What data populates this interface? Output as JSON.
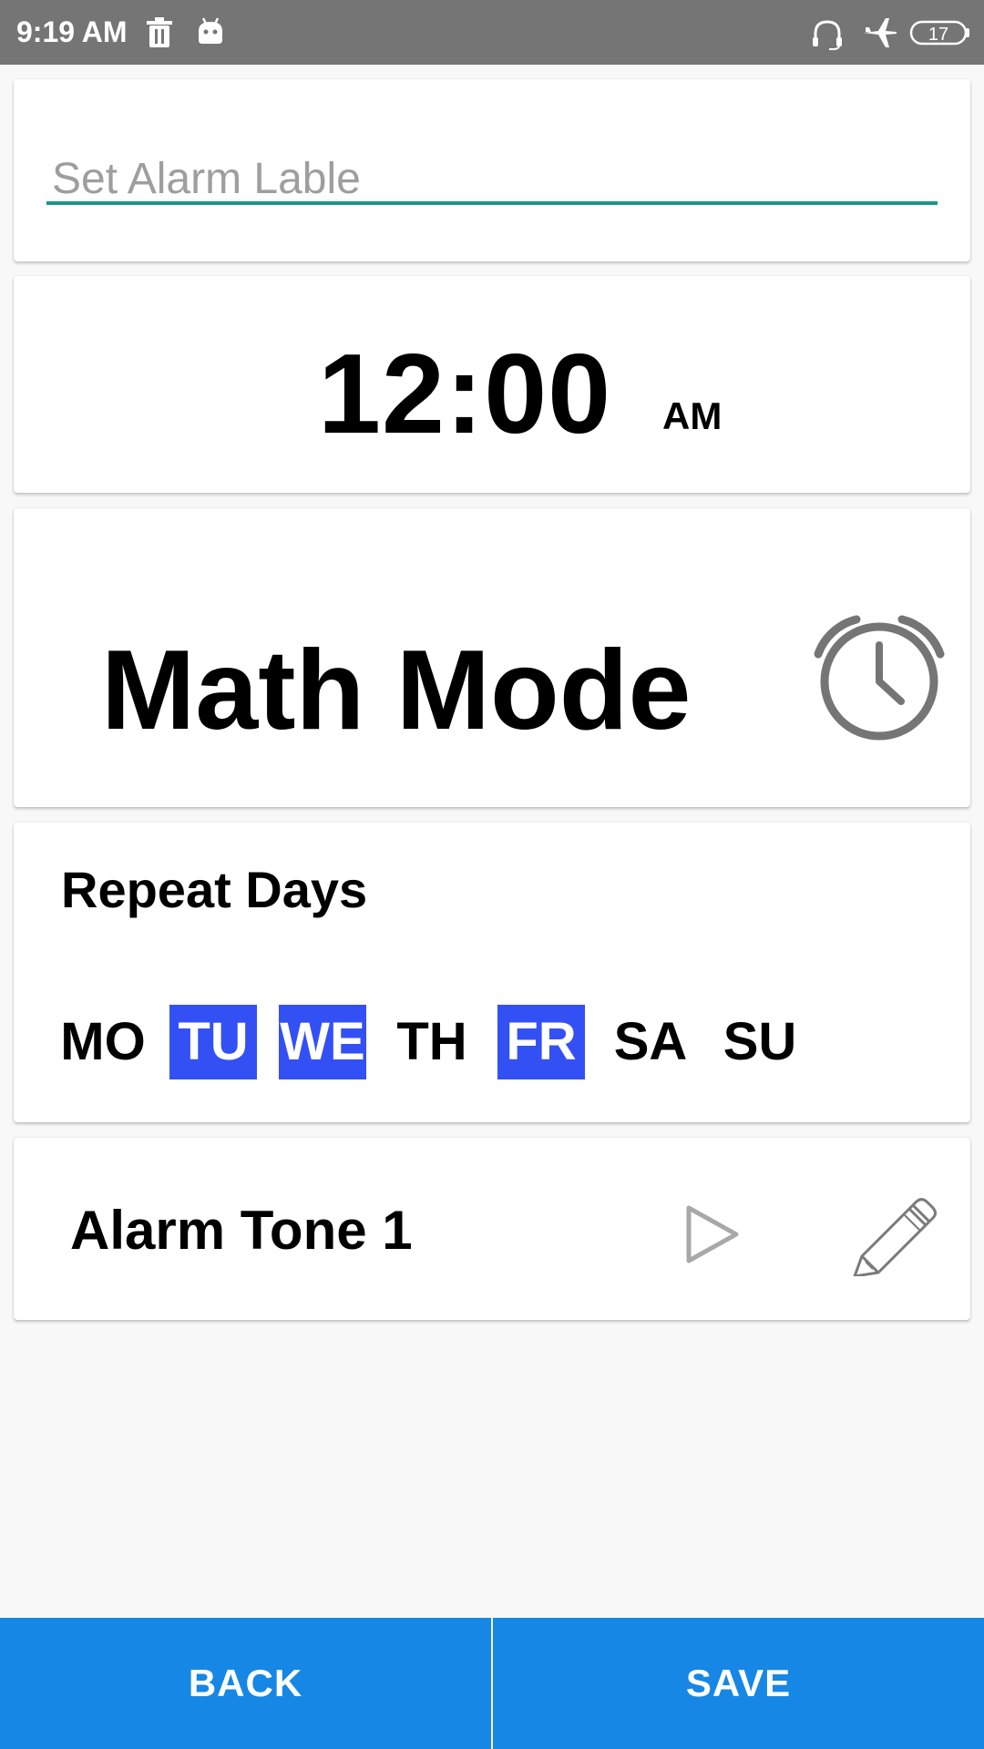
{
  "status_bar": {
    "time": "9:19 AM",
    "battery_level": "17",
    "icons": [
      "trash-icon",
      "android-icon",
      "headset-icon",
      "airplane-mode-icon",
      "battery-icon"
    ]
  },
  "alarm_label": {
    "value": "",
    "placeholder": "Set Alarm Lable"
  },
  "time": {
    "value": "12:00",
    "period": "AM"
  },
  "mode": {
    "label": "Math Mode",
    "icon": "alarm-clock-icon"
  },
  "repeat": {
    "title": "Repeat Days",
    "days": [
      {
        "label": "MO",
        "selected": false
      },
      {
        "label": "TU",
        "selected": true
      },
      {
        "label": "WE",
        "selected": true
      },
      {
        "label": "TH",
        "selected": false
      },
      {
        "label": "FR",
        "selected": true
      },
      {
        "label": "SA",
        "selected": false
      },
      {
        "label": "SU",
        "selected": false
      }
    ],
    "selected_color": "#3350f5"
  },
  "tone": {
    "name": "Alarm Tone 1",
    "play_icon": "play-icon",
    "edit_icon": "pencil-icon"
  },
  "buttons": {
    "back": "BACK",
    "save": "SAVE",
    "color": "#1687e4"
  },
  "colors": {
    "status_bar": "#757575",
    "input_underline": "#1a9688",
    "background": "#f8f8f8"
  }
}
